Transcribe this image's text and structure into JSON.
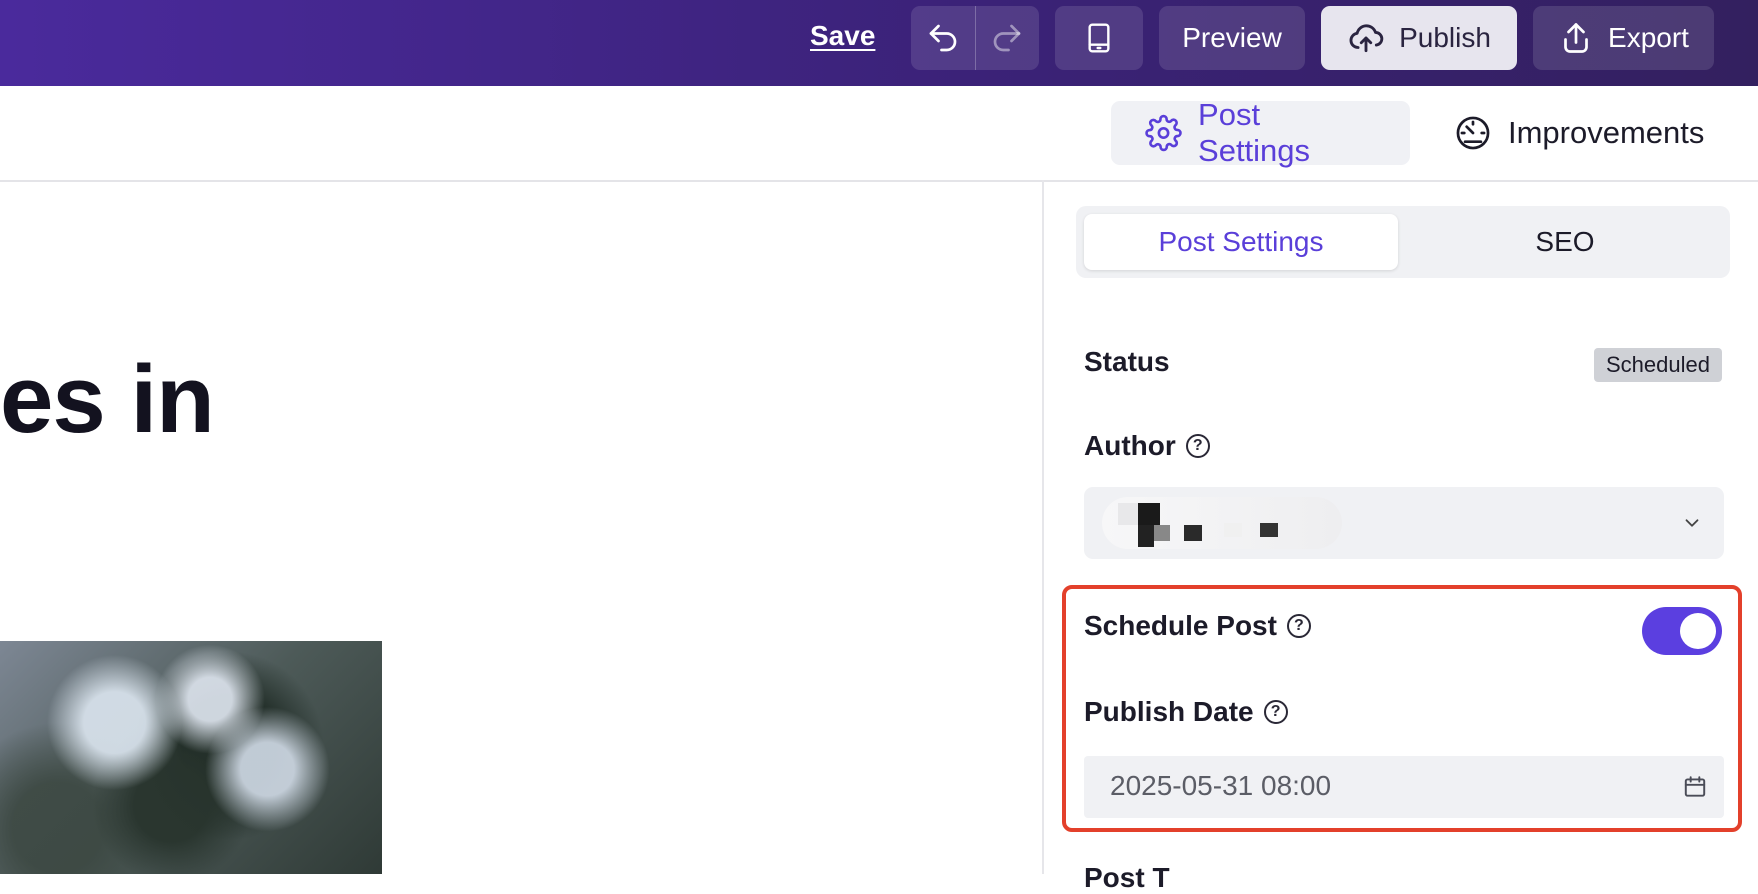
{
  "topbar": {
    "save_label": "Save",
    "undo_icon": "undo-icon",
    "redo_icon": "redo-icon",
    "mobile_preview_icon": "tablet-icon",
    "preview_label": "Preview",
    "publish_label": "Publish",
    "export_label": "Export",
    "accent_color": "#4a2a9c"
  },
  "subheader": {
    "tabs": [
      {
        "label": "Post Settings",
        "icon": "gear-icon",
        "active": true
      },
      {
        "label": "Improvements",
        "icon": "gauge-icon",
        "active": false
      }
    ]
  },
  "canvas": {
    "heading_fragment": "es in"
  },
  "panel": {
    "segments": [
      {
        "label": "Post Settings",
        "active": true
      },
      {
        "label": "SEO",
        "active": false
      }
    ],
    "status": {
      "label": "Status",
      "value": "Scheduled"
    },
    "author": {
      "label": "Author"
    },
    "schedule_post": {
      "label": "Schedule Post",
      "enabled": true
    },
    "publish_date": {
      "label": "Publish Date",
      "value": "2025-05-31 08:00"
    },
    "next_label_partial": "Post T",
    "toggle_color": "#5b3fe0",
    "highlight_color": "#e3402b"
  }
}
